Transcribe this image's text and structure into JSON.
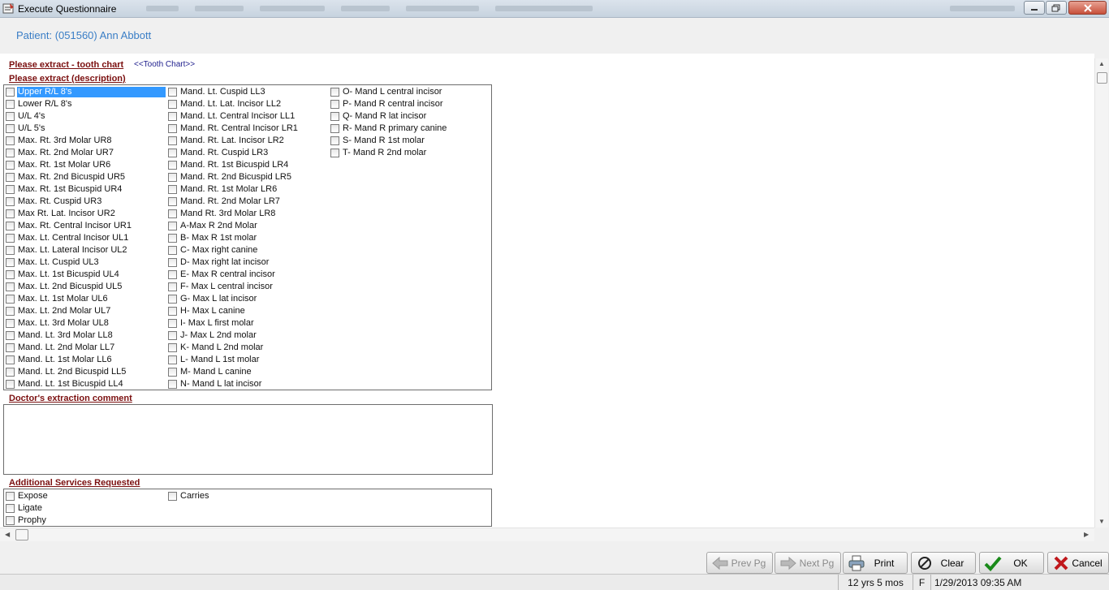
{
  "window": {
    "title": "Execute Questionnaire"
  },
  "patient": {
    "label": "Patient: (051560) Ann Abbott"
  },
  "sections": {
    "tooth_chart": {
      "label": "Please extract - tooth chart",
      "link": "<<Tooth Chart>>"
    },
    "description": {
      "label": "Please extract (description)"
    },
    "comment": {
      "label": "Doctor's extraction comment",
      "value": ""
    },
    "services": {
      "label": "Additional Services Requested"
    }
  },
  "extract_options": {
    "col1": [
      "Upper R/L 8's",
      "Lower R/L 8's",
      "U/L 4's",
      "U/L 5's",
      "Max. Rt. 3rd Molar UR8",
      "Max. Rt. 2nd Molar UR7",
      "Max. Rt. 1st Molar UR6",
      "Max. Rt. 2nd Bicuspid UR5",
      "Max. Rt. 1st Bicuspid UR4",
      "Max. Rt. Cuspid UR3",
      "Max Rt. Lat. Incisor UR2",
      "Max. Rt. Central Incisor UR1",
      "Max. Lt. Central Incisor UL1",
      "Max. Lt. Lateral Incisor UL2",
      "Max. Lt. Cuspid UL3",
      "Max. Lt. 1st Bicuspid UL4",
      "Max. Lt. 2nd Bicuspid UL5",
      "Max. Lt. 1st Molar UL6",
      "Max. Lt. 2nd Molar UL7",
      "Max. Lt. 3rd Molar UL8",
      "Mand. Lt. 3rd Molar LL8",
      "Mand. Lt. 2nd Molar LL7",
      "Mand. Lt. 1st Molar LL6",
      "Mand. Lt. 2nd Bicuspid LL5",
      "Mand. Lt. 1st Bicuspid LL4"
    ],
    "col2": [
      "Mand. Lt. Cuspid LL3",
      "Mand. Lt. Lat. Incisor LL2",
      "Mand. Lt. Central Incisor LL1",
      "Mand. Rt. Central Incisor LR1",
      "Mand. Rt. Lat. Incisor LR2",
      "Mand. Rt. Cuspid LR3",
      "Mand. Rt. 1st Bicuspid LR4",
      "Mand. Rt. 2nd Bicuspid LR5",
      "Mand. Rt. 1st Molar LR6",
      "Mand. Rt. 2nd Molar LR7",
      "Mand Rt. 3rd Molar LR8",
      "A-Max R 2nd Molar",
      "B- Max R 1st molar",
      "C- Max right canine",
      "D- Max right lat incisor",
      "E- Max R central incisor",
      "F- Max L central incisor",
      "G- Max L lat incisor",
      "H- Max L canine",
      "I- Max L first molar",
      "J- Max L 2nd molar",
      "K- Mand L 2nd molar",
      "L- Mand L 1st molar",
      "M- Mand L canine",
      "N- Mand L lat incisor"
    ],
    "col3": [
      "O- Mand L central incisor",
      "P- Mand R central incisor",
      "Q- Mand R lat incisor",
      "R- Mand R primary canine",
      "S- Mand R 1st molar",
      "T- Mand R 2nd molar"
    ]
  },
  "services_options": {
    "col1": [
      "Expose",
      "Ligate",
      "Prophy"
    ],
    "col2": [
      "Carries"
    ]
  },
  "footer": {
    "prev": "Prev Pg",
    "next": "Next Pg",
    "print": "Print",
    "clear": "Clear",
    "ok": "OK",
    "cancel": "Cancel"
  },
  "status": {
    "age": "12 yrs 5 mos",
    "sex": "F",
    "datetime": "1/29/2013 09:35 AM"
  },
  "colors": {
    "accent_blue": "#3a7ec6",
    "section_red": "#7b1010",
    "selection": "#3399ff"
  }
}
